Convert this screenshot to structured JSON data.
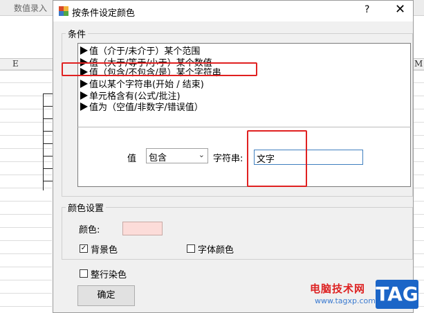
{
  "background": {
    "tab_label": "数值录入",
    "col_e": "E",
    "col_m": "M"
  },
  "dialog": {
    "title": "按条件设定颜色",
    "help_label": "?",
    "close_label": "✕",
    "conditions_group_label": "条件",
    "condition_items": [
      "值（介于/未介于）某个范围",
      "值（大于/等于/小于）某个数值",
      "值（包含/不包含/是）某个字符串",
      "值以某个字符串(开始 / 结束)",
      "单元格含有(公式/批注)",
      "值为（空值/非数字/错误值）"
    ],
    "value_label": "值",
    "operator_selected": "包含",
    "string_label": "字符串:",
    "string_value": "文字",
    "color_group_label": "颜色设置",
    "color_label": "颜色:",
    "swatch_color": "#fcdcd9",
    "bg_color_label": "背景色",
    "bg_color_checked": true,
    "font_color_label": "字体颜色",
    "font_color_checked": false,
    "whole_row_label": "整行染色",
    "whole_row_checked": false,
    "ok_label": "确定",
    "highlight_color": "#e02020"
  },
  "watermark": {
    "site_name": "电脑技术网",
    "url": "www.tagxp.com",
    "tag": "TAG"
  }
}
